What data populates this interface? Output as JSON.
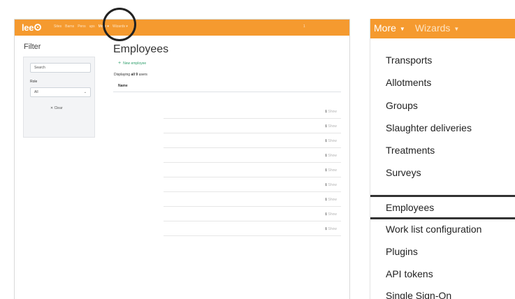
{
  "left": {
    "logo_text": "lee",
    "nav_links": [
      "Sites",
      "Barns",
      "Pens",
      "ups",
      "More ▾",
      "Wizards ▾"
    ],
    "nav_user": "1",
    "filter": {
      "title": "Filter",
      "search_placeholder": "Search",
      "role_label": "Role",
      "role_value": "All",
      "clear_label": "✕ Clear"
    },
    "page_title": "Employees",
    "new_employee_label": "New employee",
    "displaying": {
      "prefix": "Displaying ",
      "bold": "all 9",
      "suffix": " users"
    },
    "column_header": "Name",
    "rows": [
      "Show",
      "Show",
      "Show",
      "Show",
      "Show",
      "Show",
      "Show",
      "Show",
      "Show"
    ]
  },
  "right": {
    "nav": {
      "more": "More",
      "wizards": "Wizards"
    },
    "menu_items": [
      "Transports",
      "Allotments",
      "Groups",
      "Slaughter deliveries",
      "Treatments",
      "Surveys"
    ],
    "menu_items_2": [
      "Employees",
      "Work list configuration",
      "Plugins",
      "API tokens",
      "Single Sign-On"
    ],
    "highlighted_item": "Employees"
  },
  "colors": {
    "brand": "#f59a2f",
    "link_green": "#2e9e6b"
  }
}
